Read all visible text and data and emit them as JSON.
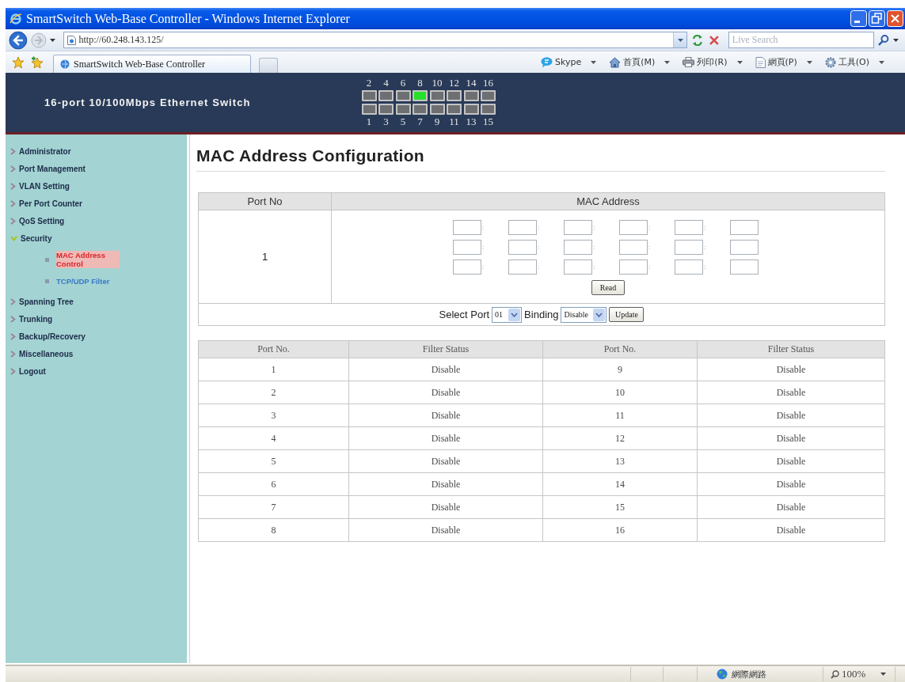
{
  "window": {
    "title": "SmartSwitch Web-Base Controller - Windows Internet Explorer"
  },
  "address_bar": {
    "url": "http://60.248.143.125/",
    "search_placeholder": "Live Search"
  },
  "tabs": [
    {
      "label": "SmartSwitch Web-Base Controller",
      "selected": true
    }
  ],
  "command_bar": [
    {
      "kind": "skype",
      "label": "Skype"
    },
    {
      "kind": "home",
      "label": "首頁(M)"
    },
    {
      "kind": "print",
      "label": "列印(R)"
    },
    {
      "kind": "page",
      "label": "網頁(P)"
    },
    {
      "kind": "tools",
      "label": "工具(O)"
    }
  ],
  "banner": {
    "title": "16-port 10/100Mbps Ethernet Switch",
    "ports_top": [
      {
        "label": "2",
        "lit": false
      },
      {
        "label": "4",
        "lit": false
      },
      {
        "label": "6",
        "lit": false
      },
      {
        "label": "8",
        "lit": true
      },
      {
        "label": "10",
        "lit": false
      },
      {
        "label": "12",
        "lit": false
      },
      {
        "label": "14",
        "lit": false
      },
      {
        "label": "16",
        "lit": false
      }
    ],
    "ports_bottom": [
      {
        "label": "1",
        "lit": false
      },
      {
        "label": "3",
        "lit": false
      },
      {
        "label": "5",
        "lit": false
      },
      {
        "label": "7",
        "lit": false
      },
      {
        "label": "9",
        "lit": false
      },
      {
        "label": "11",
        "lit": false
      },
      {
        "label": "13",
        "lit": false
      },
      {
        "label": "15",
        "lit": false
      }
    ]
  },
  "sidebar": {
    "items": [
      {
        "label": "Administrator",
        "expanded": false
      },
      {
        "label": "Port Management",
        "expanded": false
      },
      {
        "label": "VLAN Setting",
        "expanded": false
      },
      {
        "label": "Per Port Counter",
        "expanded": false
      },
      {
        "label": "QoS Setting",
        "expanded": false
      },
      {
        "label": "Security",
        "expanded": true,
        "children": [
          {
            "label": "MAC Address Control",
            "selected": true
          },
          {
            "label": "TCP/UDP Filter",
            "selected": false
          }
        ]
      },
      {
        "label": "Spanning Tree",
        "expanded": false
      },
      {
        "label": "Trunking",
        "expanded": false
      },
      {
        "label": "Backup/Recovery",
        "expanded": false
      },
      {
        "label": "Miscellaneous",
        "expanded": false
      },
      {
        "label": "Logout",
        "expanded": false
      }
    ]
  },
  "page_title": "MAC Address Configuration",
  "mac_table": {
    "columns": [
      "Port No",
      "MAC Address"
    ],
    "port": "1",
    "mac_rows": [
      {
        "fields": [
          {
            "kind": "text",
            "separator": ":"
          },
          {
            "kind": "text",
            "separator": ":"
          },
          {
            "kind": "text",
            "separator": ":"
          },
          {
            "kind": "text",
            "separator": ":"
          },
          {
            "kind": "text",
            "separator": ":"
          },
          {
            "kind": "text"
          }
        ]
      },
      {
        "fields": [
          {
            "kind": "text",
            "separator": ":"
          },
          {
            "kind": "text",
            "separator": ":"
          },
          {
            "kind": "text",
            "separator": ":"
          },
          {
            "kind": "text",
            "separator": ":"
          },
          {
            "kind": "text",
            "separator": ":"
          },
          {
            "kind": "text"
          }
        ]
      },
      {
        "fields": [
          {
            "kind": "text",
            "separator": ":"
          },
          {
            "kind": "text",
            "separator": ":"
          },
          {
            "kind": "text",
            "separator": ":"
          },
          {
            "kind": "text",
            "separator": ":"
          },
          {
            "kind": "text",
            "separator": ":"
          },
          {
            "kind": "text"
          }
        ]
      }
    ],
    "read_button": "Read",
    "select_port": {
      "label": "Select Port",
      "value": "01"
    },
    "binding": {
      "label": "Binding",
      "value": "Disable"
    },
    "update_button": "Update"
  },
  "filter_table": {
    "columns": [
      "Port No.",
      "Filter Status",
      "Port No.",
      "Filter Status"
    ],
    "rows": [
      [
        "1",
        "Disable",
        "9",
        "Disable"
      ],
      [
        "2",
        "Disable",
        "10",
        "Disable"
      ],
      [
        "3",
        "Disable",
        "11",
        "Disable"
      ],
      [
        "4",
        "Disable",
        "12",
        "Disable"
      ],
      [
        "5",
        "Disable",
        "13",
        "Disable"
      ],
      [
        "6",
        "Disable",
        "14",
        "Disable"
      ],
      [
        "7",
        "Disable",
        "15",
        "Disable"
      ],
      [
        "8",
        "Disable",
        "16",
        "Disable"
      ]
    ]
  },
  "status_bar": {
    "zone": "網際網路",
    "zoom": "100%"
  }
}
